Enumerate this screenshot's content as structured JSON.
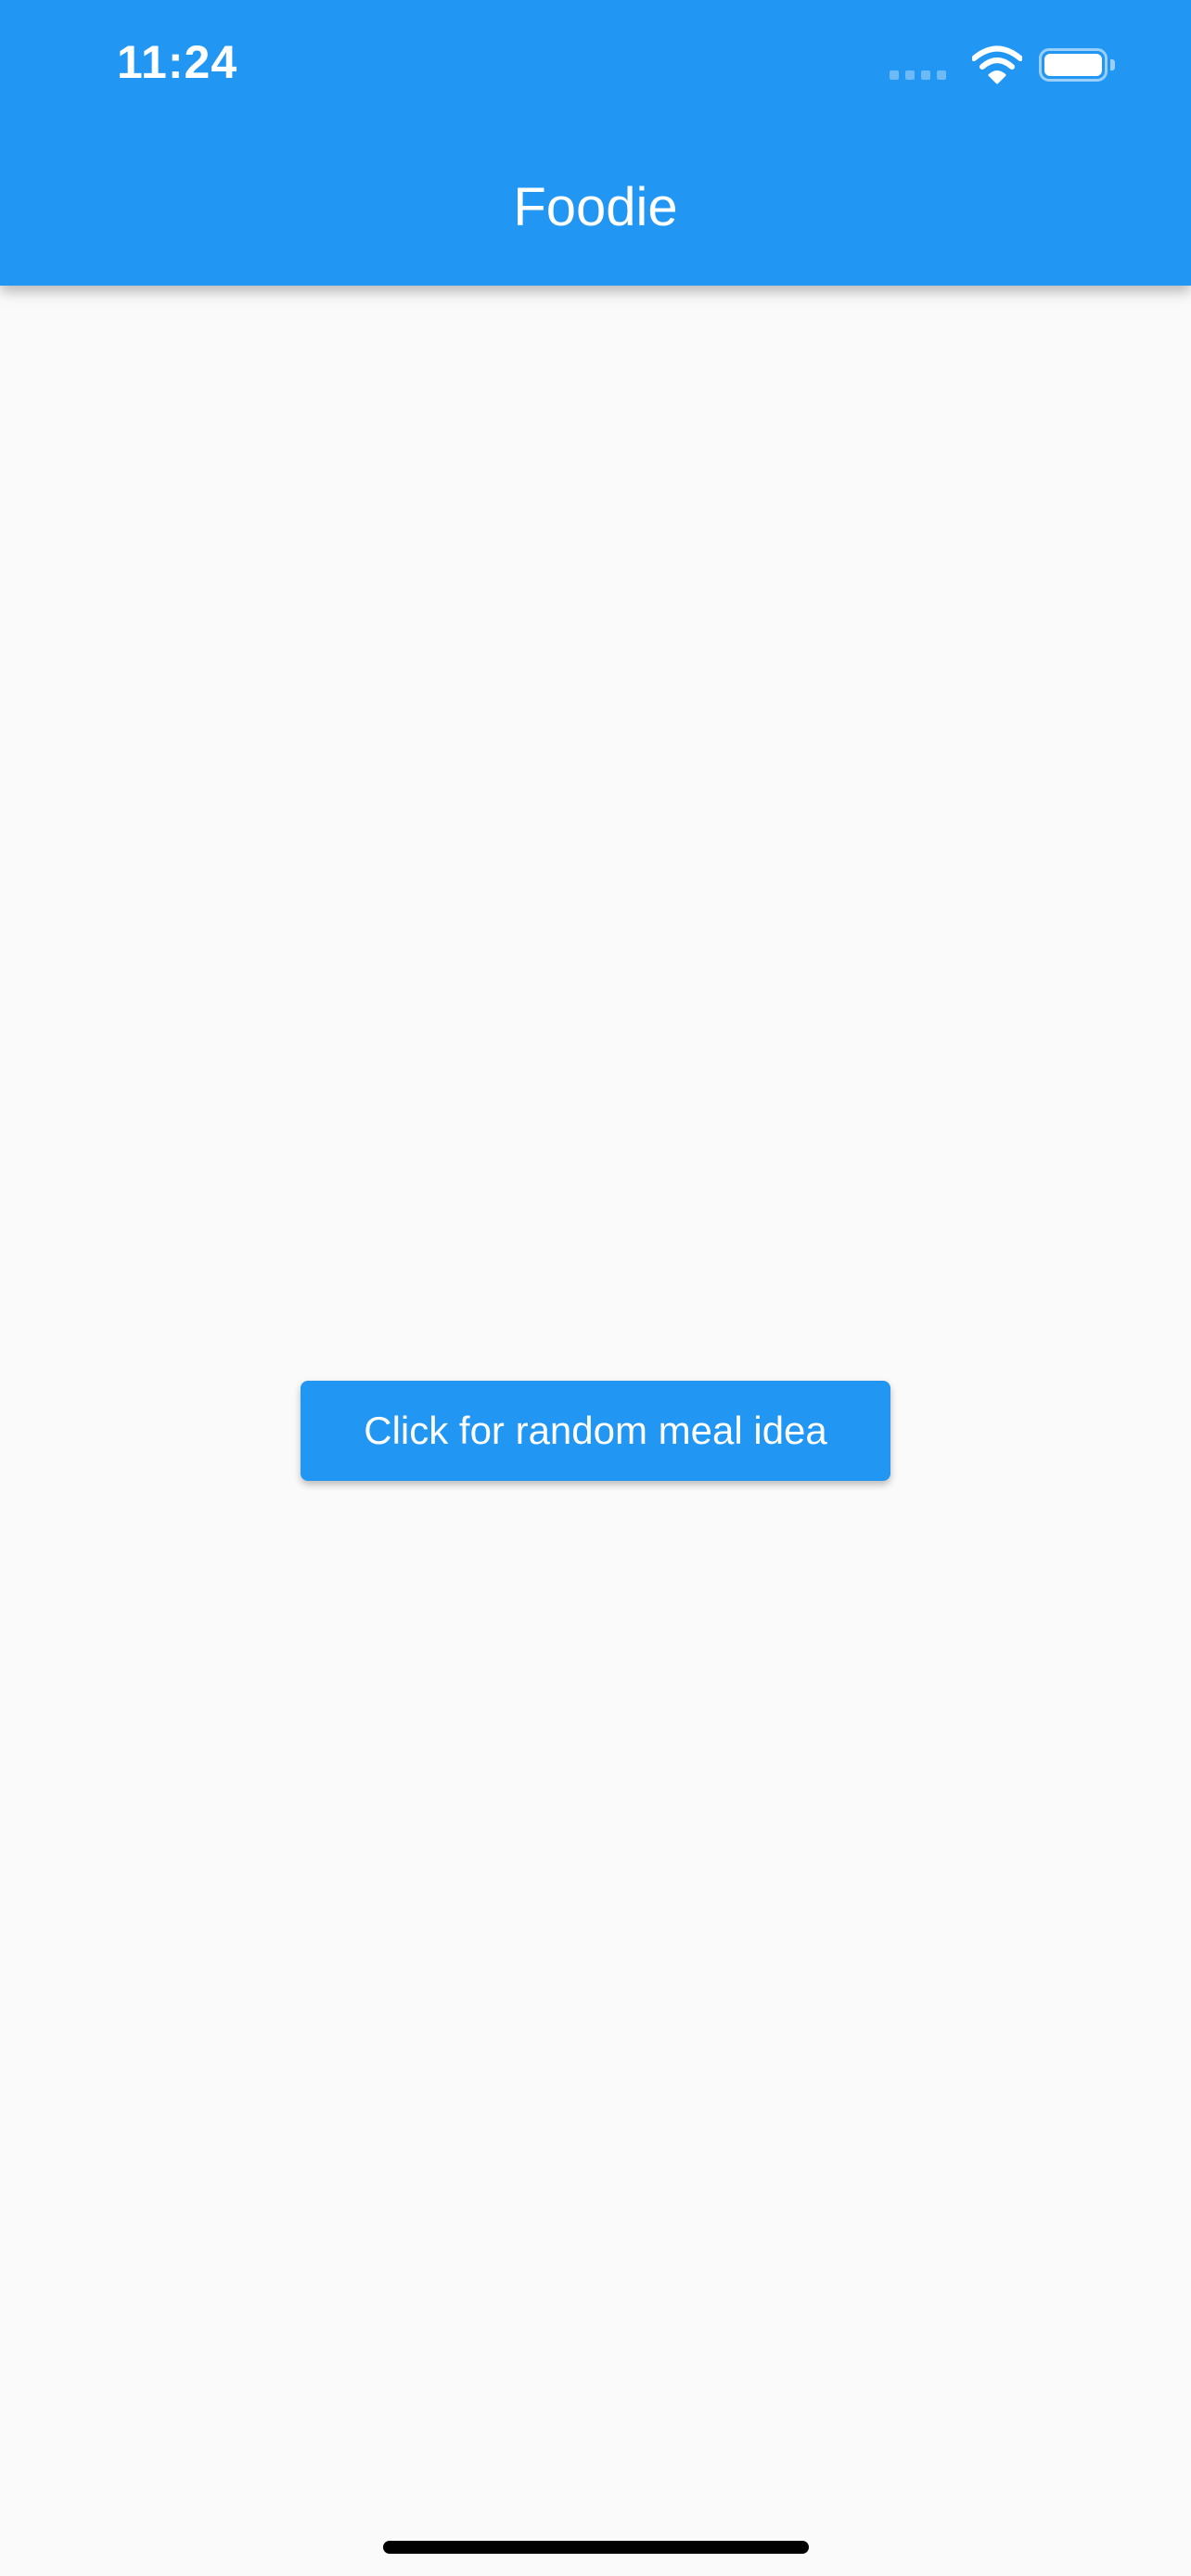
{
  "status_bar": {
    "time": "11:24",
    "icons": [
      "cellular-signal-icon",
      "wifi-icon",
      "battery-icon"
    ]
  },
  "app_bar": {
    "title": "Foodie"
  },
  "main": {
    "random_meal_button_label": "Click for random meal idea"
  },
  "colors": {
    "primary": "#2196f3",
    "background": "#fafafa",
    "on_primary": "#ffffff"
  }
}
